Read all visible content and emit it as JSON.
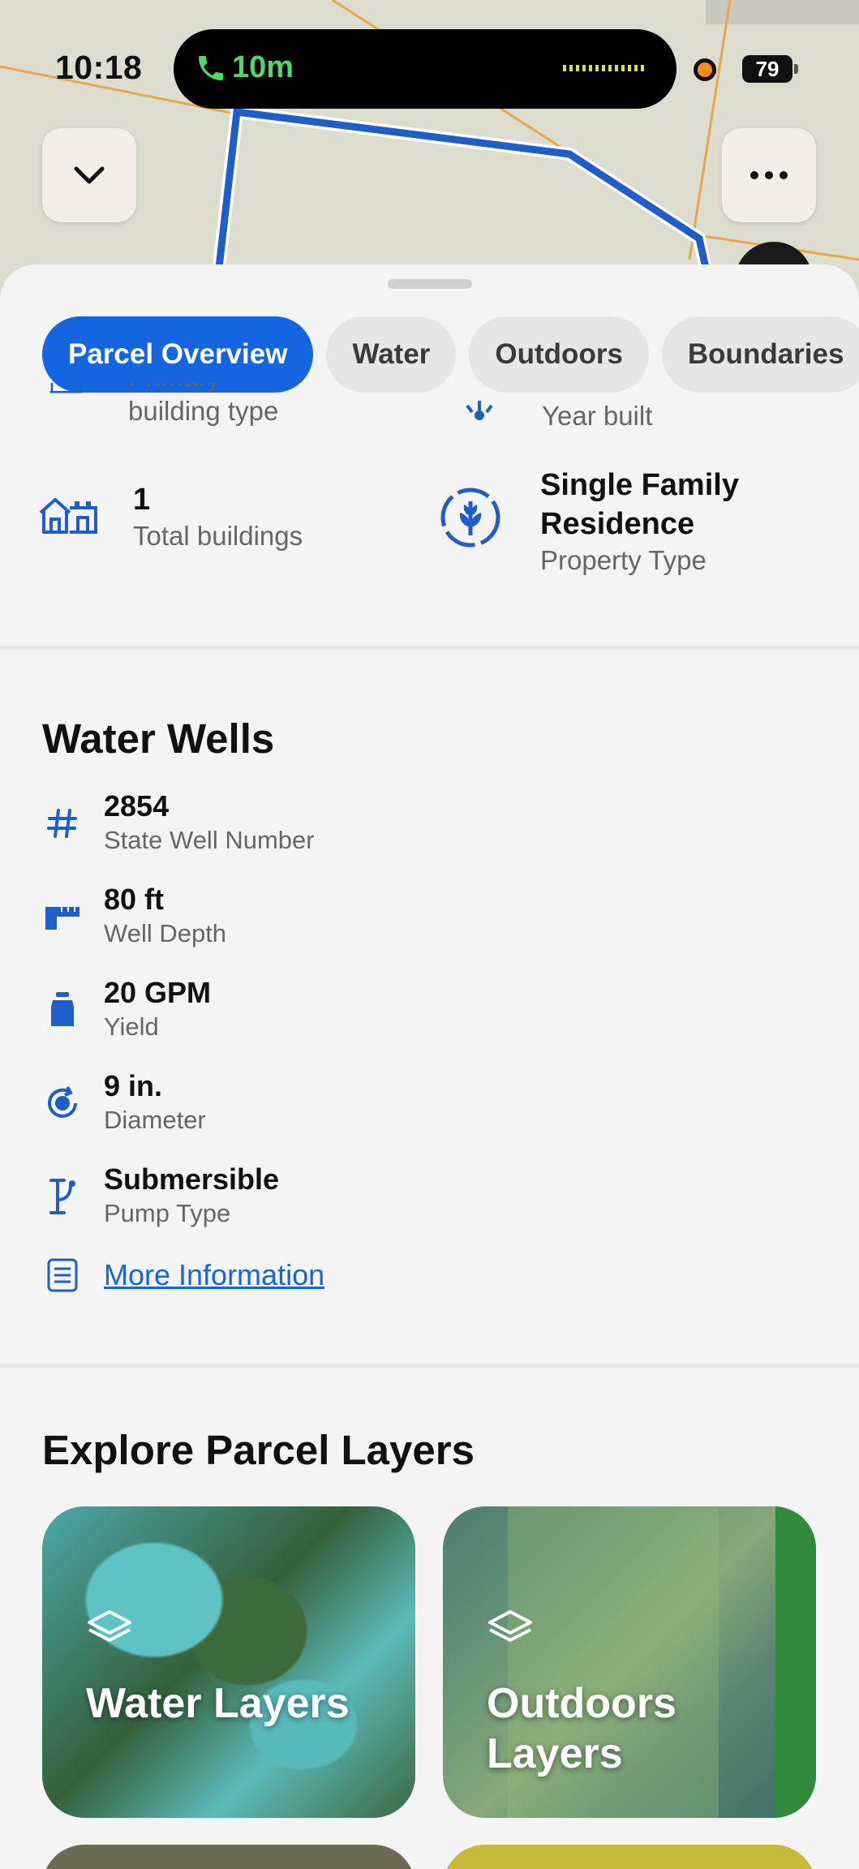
{
  "status_bar": {
    "time": "10:18",
    "call_duration": "10m",
    "battery": "79"
  },
  "map": {
    "collapse_icon": "chevron-down-icon",
    "more_icon": "ellipsis-icon"
  },
  "tabs": [
    {
      "label": "Parcel Overview",
      "active": true
    },
    {
      "label": "Water",
      "active": false
    },
    {
      "label": "Outdoors",
      "active": false
    },
    {
      "label": "Boundaries",
      "active": false
    }
  ],
  "building": {
    "primary_type_label": "building type",
    "primary_type_label_top": "Primary",
    "year_built_label": "Year built",
    "total_buildings_value": "1",
    "total_buildings_label": "Total buildings",
    "property_type_value": "Single Family Residence",
    "property_type_label": "Property Type"
  },
  "water_wells": {
    "title": "Water Wells",
    "rows": [
      {
        "icon": "hash-icon",
        "value": "2854",
        "label": "State Well Number"
      },
      {
        "icon": "ruler-icon",
        "value": "80 ft",
        "label": "Well Depth"
      },
      {
        "icon": "jug-icon",
        "value": "20 GPM",
        "label": "Yield"
      },
      {
        "icon": "diameter-icon",
        "value": "9 in.",
        "label": "Diameter"
      },
      {
        "icon": "pump-icon",
        "value": "Submersible",
        "label": "Pump Type"
      }
    ],
    "more_link": "More Information"
  },
  "explore": {
    "title": "Explore Parcel Layers",
    "cards": [
      {
        "title": "Water Layers",
        "icon": "layers-icon"
      },
      {
        "title": "Outdoors Layers",
        "icon": "layers-icon"
      }
    ]
  },
  "colors": {
    "accent": "#1565e0",
    "call_green": "#4cd964",
    "parcel_outline": "#1f5ec9"
  }
}
